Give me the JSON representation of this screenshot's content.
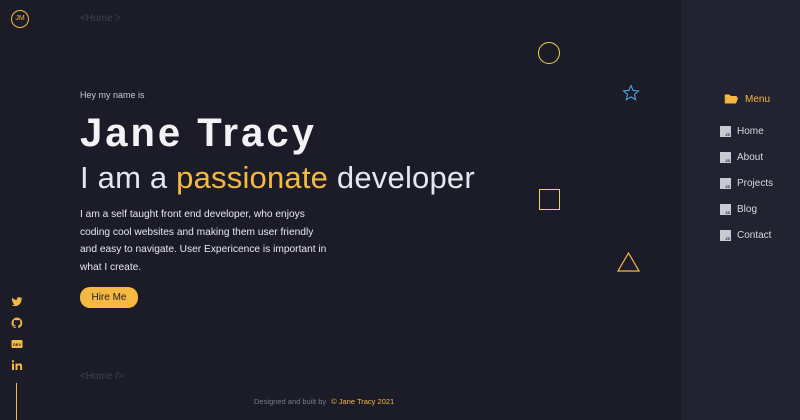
{
  "brand": {
    "logo_text": "JM"
  },
  "tags": {
    "open": "<Home >",
    "close": "<Home />"
  },
  "hero": {
    "greeting": "Hey my name is",
    "name": "Jane Tracy",
    "tagline_prefix": "I am a ",
    "tagline_accent": "passionate",
    "tagline_suffix": " developer",
    "description": "I am a self taught front end developer, who enjoys coding cool websites and making them user friendly and easy to navigate. User Expericence is important in what I create.",
    "cta_label": "Hire Me"
  },
  "socials": [
    {
      "icon": "twitter-icon"
    },
    {
      "icon": "github-icon"
    },
    {
      "icon": "dev-icon",
      "text": "DEV"
    },
    {
      "icon": "linkedin-icon",
      "text": "in"
    }
  ],
  "footer": {
    "text": "Designed and built by",
    "credit": "© Jane Tracy 2021"
  },
  "menu": {
    "title": "Menu",
    "icon": "folder-open-icon",
    "items": [
      {
        "label": "Home",
        "icon": "js-file-icon",
        "icon_text": "JS"
      },
      {
        "label": "About",
        "icon": "js-file-icon",
        "icon_text": "JS"
      },
      {
        "label": "Projects",
        "icon": "js-file-icon",
        "icon_text": "JS"
      },
      {
        "label": "Blog",
        "icon": "js-file-icon",
        "icon_text": "JS"
      },
      {
        "label": "Contact",
        "icon": "js-file-icon",
        "icon_text": "JS"
      }
    ]
  },
  "colors": {
    "background": "#1c1c28",
    "panel": "#222230",
    "accent": "#f5b941",
    "decor": "#e8d84a",
    "star": "#4aa8e8"
  }
}
